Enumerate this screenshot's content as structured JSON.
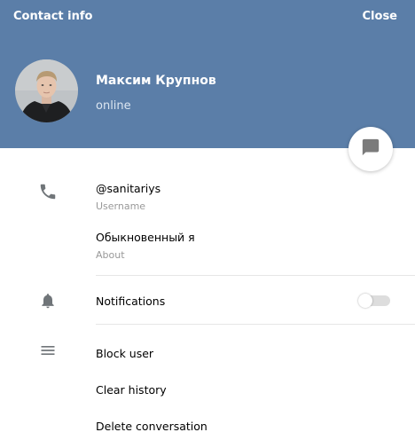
{
  "header": {
    "title": "Contact info",
    "close_label": "Close",
    "background_color": "#5b7ea8"
  },
  "user": {
    "name": "Максим Крупнов",
    "status": "online"
  },
  "info": {
    "username": "@sanitariys",
    "username_label": "Username",
    "about": "Обыкновенный я",
    "about_label": "About"
  },
  "notifications": {
    "label": "Notifications",
    "enabled": false
  },
  "actions": {
    "block_user": "Block user",
    "clear_history": "Clear history",
    "delete_conversation": "Delete conversation"
  },
  "icons": {
    "message": "message-icon",
    "phone": "phone-icon",
    "bell": "bell-icon",
    "menu": "menu-icon"
  }
}
